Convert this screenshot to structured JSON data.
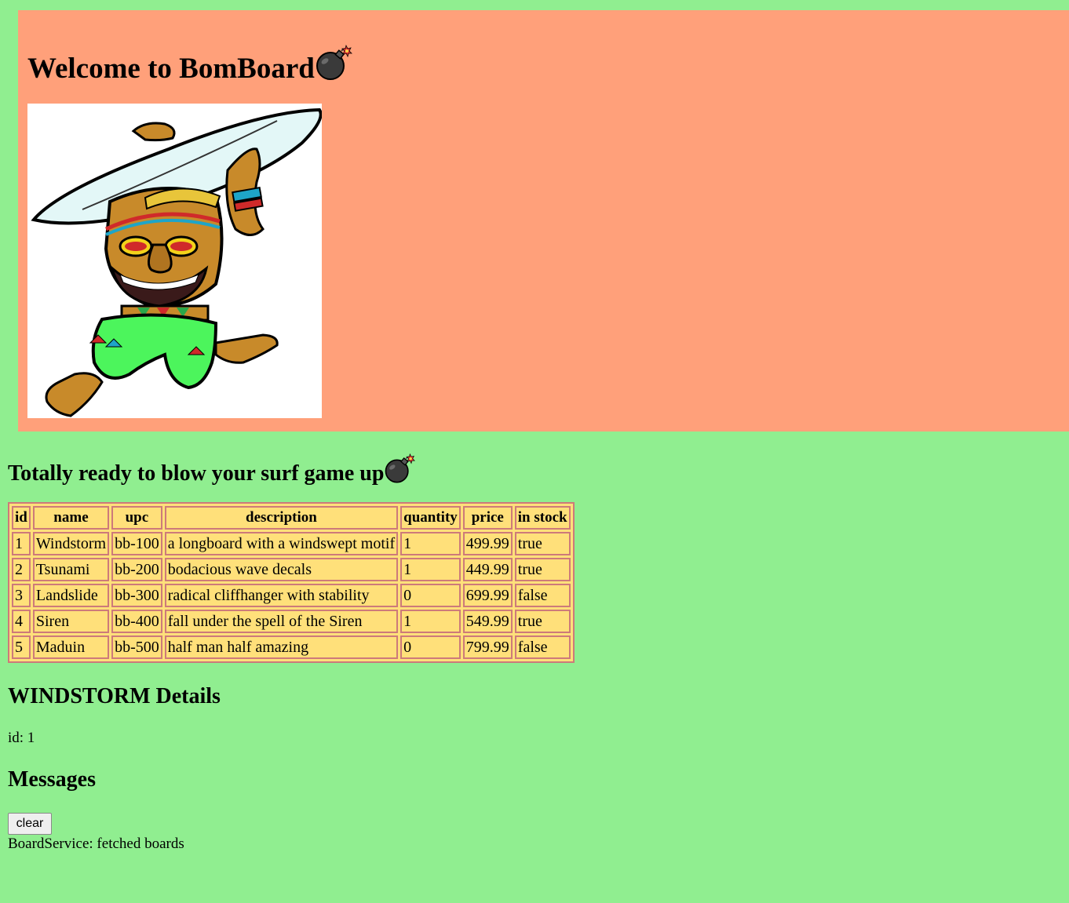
{
  "header": {
    "title": "Welcome to BomBoard",
    "title_icon": "bomb-icon"
  },
  "tagline": {
    "text": "Totally ready to blow your surf game up",
    "icon": "bomb-icon"
  },
  "board_table": {
    "headers": [
      "id",
      "name",
      "upc",
      "description",
      "quantity",
      "price",
      "in stock"
    ],
    "rows": [
      [
        "1",
        "Windstorm",
        "bb-100",
        "a longboard with a windswept motif",
        "1",
        "499.99",
        "true"
      ],
      [
        "2",
        "Tsunami",
        "bb-200",
        "bodacious wave decals",
        "1",
        "449.99",
        "true"
      ],
      [
        "3",
        "Landslide",
        "bb-300",
        "radical cliffhanger with stability",
        "0",
        "699.99",
        "false"
      ],
      [
        "4",
        "Siren",
        "bb-400",
        "fall under the spell of the Siren",
        "1",
        "549.99",
        "true"
      ],
      [
        "5",
        "Maduin",
        "bb-500",
        "half man half amazing",
        "0",
        "799.99",
        "false"
      ]
    ]
  },
  "details": {
    "heading": "WINDSTORM Details",
    "id_line": "id: 1"
  },
  "messages": {
    "heading": "Messages",
    "clear_label": "clear",
    "items": [
      "BoardService: fetched boards"
    ]
  },
  "colors": {
    "page_background": "#90ee90",
    "banner_background": "#ffa07a",
    "table_background": "#ffe07a",
    "table_border": "#cd7a7a"
  }
}
